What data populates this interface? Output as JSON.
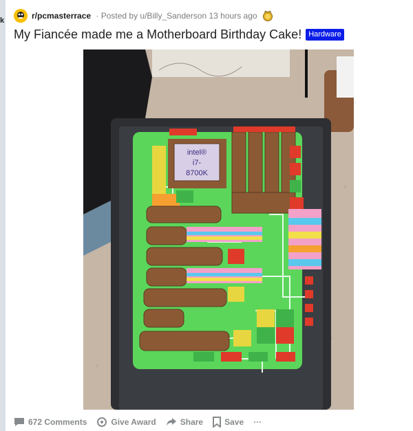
{
  "post": {
    "subreddit": "r/pcmasterrace",
    "meta": " · Posted by u/Billy_Sanderson 13 hours ago",
    "title": "My Fiancée made me a Motherboard Birthday Cake!",
    "flair": "Hardware",
    "edge_letter": "k",
    "image": {
      "cpu_label": [
        "intel®",
        "i7-",
        "8700K"
      ]
    }
  },
  "actions": {
    "comments": "672 Comments",
    "award": "Give Award",
    "share": "Share",
    "save": "Save",
    "more": "···"
  },
  "colors": {
    "flair_bg": "#0b1de8",
    "cake_green": "#5bd65a",
    "tray": "#2d2f33",
    "counter": "#c9b9a9"
  }
}
